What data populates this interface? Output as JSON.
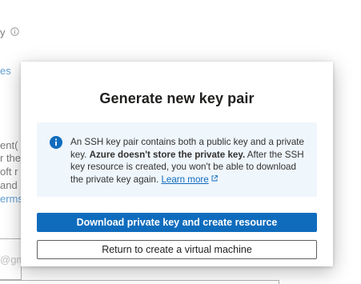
{
  "background": {
    "line1": "y",
    "line2": "es",
    "line3": "ent(",
    "line4": "r the",
    "line5": "oft r",
    "line6": "and",
    "line7": "erms",
    "input_placeholder": "@gm"
  },
  "dialog": {
    "title": "Generate new key pair",
    "info": {
      "text_part1": "An SSH key pair contains both a public key and a private key. ",
      "text_bold": "Azure doesn't store the private key.",
      "text_part2": " After the SSH key resource is created, you won't be able to download the private key again. ",
      "link": "Learn more"
    },
    "primary_button": "Download private key and create resource",
    "secondary_button": "Return to create a virtual machine"
  },
  "colors": {
    "accent": "#0f6cbd",
    "info_background": "#eff6fc"
  }
}
